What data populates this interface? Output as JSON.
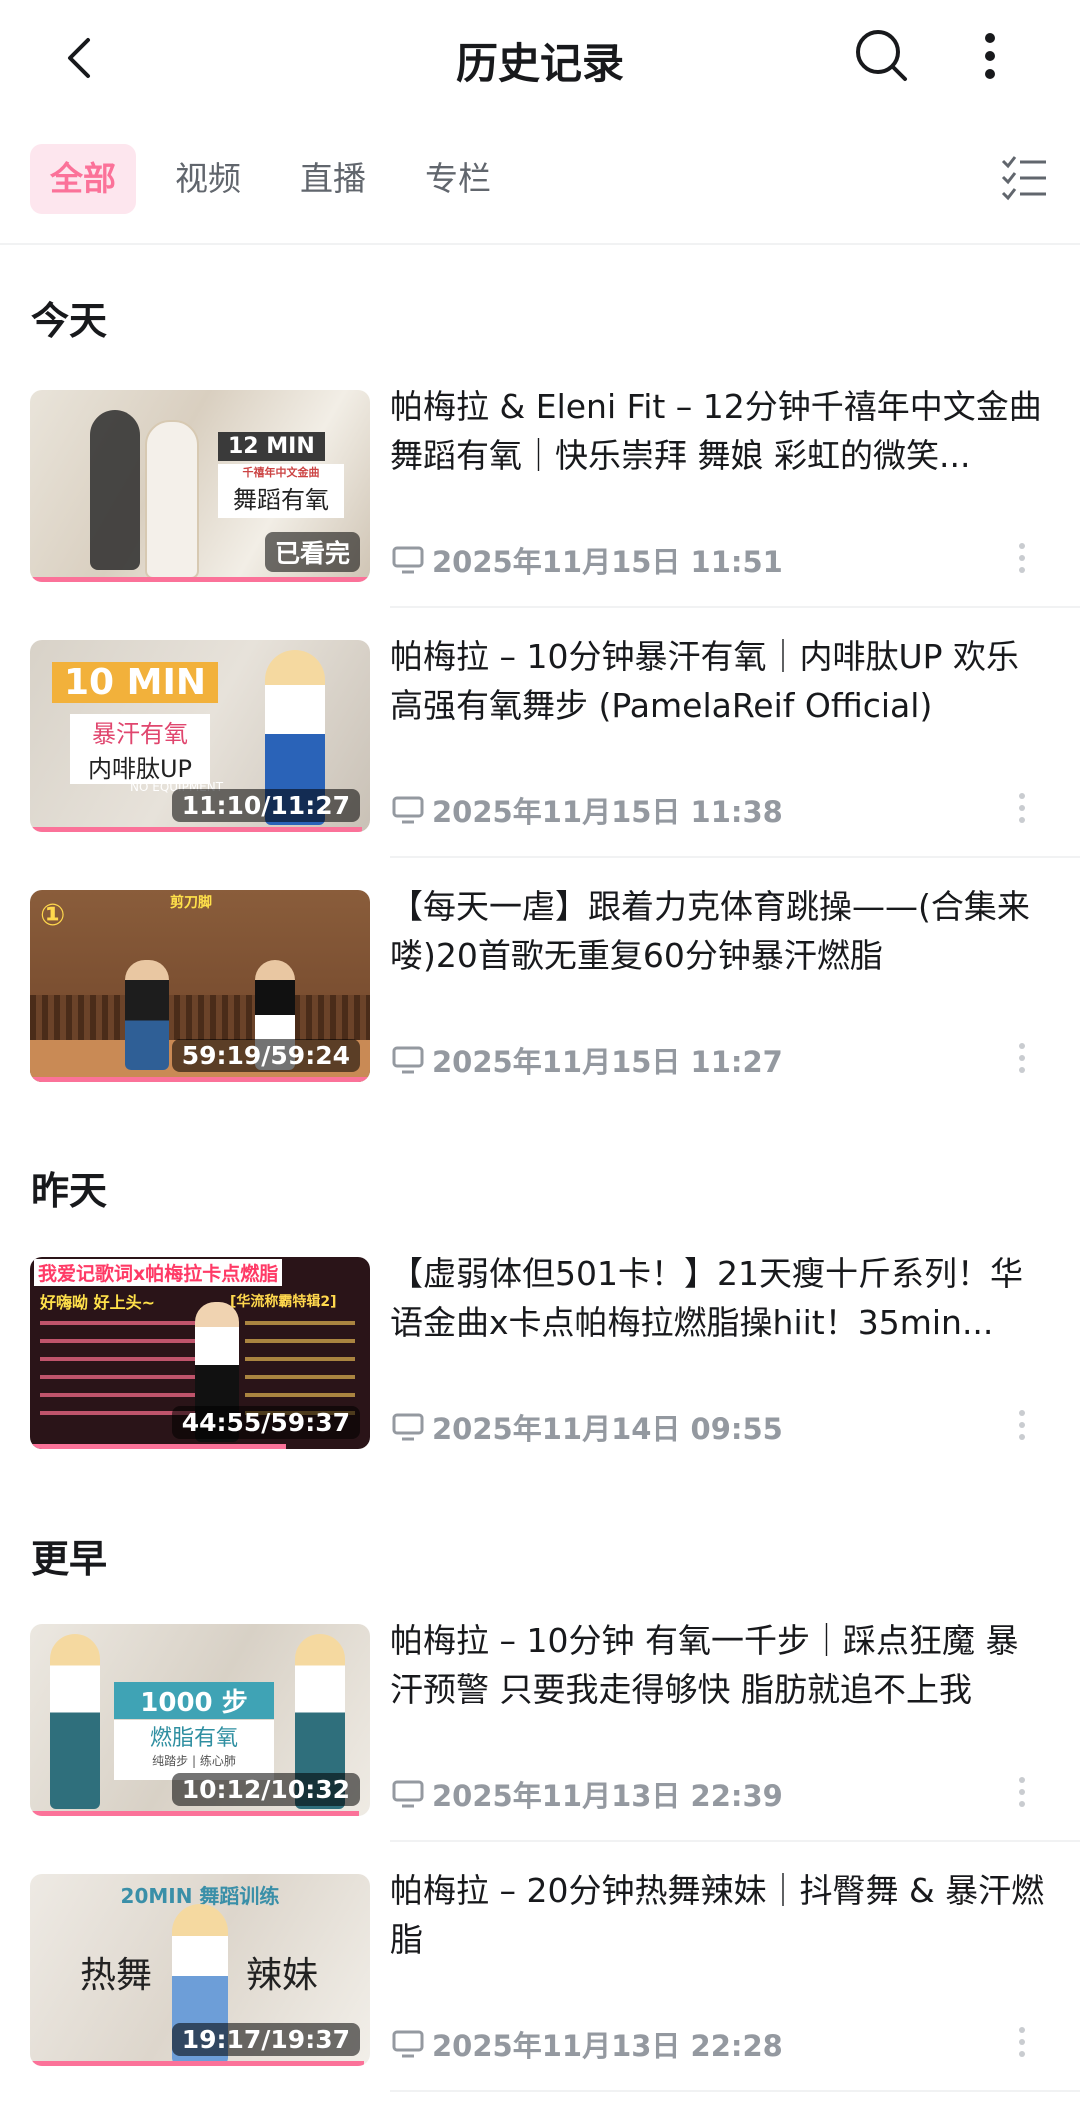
{
  "header": {
    "title": "历史记录"
  },
  "tabs": [
    {
      "label": "全部",
      "active": true
    },
    {
      "label": "视频",
      "active": false
    },
    {
      "label": "直播",
      "active": false
    },
    {
      "label": "专栏",
      "active": false
    }
  ],
  "sections": [
    {
      "label": "今天"
    },
    {
      "label": "昨天"
    },
    {
      "label": "更早"
    }
  ],
  "items": [
    {
      "title": "帕梅拉 & Eleni Fit – 12分钟千禧年中文金曲舞蹈有氧｜快乐崇拜 舞娘 彩虹的微笑...",
      "badge": "已看完",
      "thumb_text": [
        "12 MIN",
        "千禧年中文金曲",
        "舞蹈有氧"
      ],
      "date": "2025年11月15日 11:51",
      "progress": 1.0
    },
    {
      "title": "帕梅拉 – 10分钟暴汗有氧｜内啡肽UP 欢乐高强有氧舞步 (PamelaReif Official)",
      "badge": "11:10/11:27",
      "thumb_text": [
        "10 MIN",
        "暴汗有氧",
        "内啡肽UP",
        "NO EQUIPMENT"
      ],
      "date": "2025年11月15日 11:38",
      "progress": 0.975
    },
    {
      "title": "【每天一虐】跟着力克体育跳操——(合集来喽)20首歌无重复60分钟暴汗燃脂",
      "badge": "59:19/59:24",
      "thumb_text": [
        "①",
        "剪刀脚"
      ],
      "date": "2025年11月15日 11:27",
      "progress": 0.998
    },
    {
      "title": "【虚弱体但501卡！】21天瘦十斤系列！华语金曲x卡点帕梅拉燃脂操hiit！35min...",
      "badge": "44:55/59:37",
      "thumb_text": [
        "我爱记歌词x帕梅拉卡点燃脂",
        "好嗨呦 好上头~",
        "[华流称霸特辑2]"
      ],
      "date": "2025年11月14日 09:55",
      "progress": 0.753
    },
    {
      "title": "帕梅拉 – 10分钟 有氧一千步｜踩点狂魔 暴汗预警 只要我走得够快 脂肪就追不上我",
      "badge": "10:12/10:32",
      "thumb_text": [
        "1000 步",
        "燃脂有氧",
        "纯踏步 | 练心肺"
      ],
      "date": "2025年11月13日 22:39",
      "progress": 0.968
    },
    {
      "title": "帕梅拉 – 20分钟热舞辣妹｜抖臀舞 & 暴汗燃脂",
      "badge": "19:17/19:37",
      "thumb_text": [
        "20MIN 舞蹈训练",
        "热舞",
        "辣妹"
      ],
      "date": "2025年11月13日 22:28",
      "progress": 0.983
    }
  ],
  "colors": {
    "accent": "#fb7299",
    "accent_bg": "#fde6ee",
    "meta": "#9499a0"
  }
}
